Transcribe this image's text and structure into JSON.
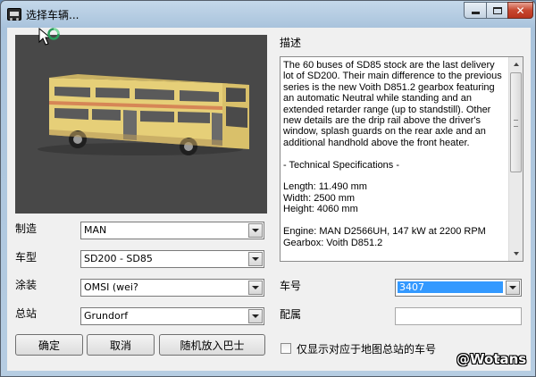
{
  "window": {
    "title": "选择车辆..."
  },
  "description": {
    "heading": "描述",
    "text": "The 60 buses of SD85 stock are the last delivery lot of SD200. Their main difference to the previous series is the new Voith D851.2 gearbox featuring an automatic Neutral while standing and an extended retarder range (up to standstill). Other new details are the drip rail above the driver's window, splash guards on the rear axle and an additional handhold above the front heater.\n\n- Technical Specifications -\n\nLength: 11.490 mm\nWidth: 2500 mm\nHeight: 4060 mm\n\nEngine: MAN D2566UH, 147 kW at 2200 RPM\nGearbox: Voith D851.2"
  },
  "form": {
    "manufacturer": {
      "label": "制造",
      "value": "MAN"
    },
    "model": {
      "label": "车型",
      "value": "SD200 - SD85"
    },
    "livery": {
      "label": "涂装",
      "value": "OMSI (wei?"
    },
    "depot": {
      "label": "总站",
      "value": "Grundorf"
    },
    "vehicle_number": {
      "label": "车号",
      "value": "3407"
    },
    "assignment": {
      "label": "配属",
      "value": ""
    }
  },
  "buttons": {
    "ok": "确定",
    "cancel": "取消",
    "random": "随机放入巴士"
  },
  "checkbox": {
    "label": "仅显示对应于地图总站的车号",
    "checked": false
  },
  "watermark": "@Wotans",
  "colors": {
    "bus_body": "#e8d37a",
    "selection": "#3399ff",
    "preview_bg": "#484848"
  }
}
